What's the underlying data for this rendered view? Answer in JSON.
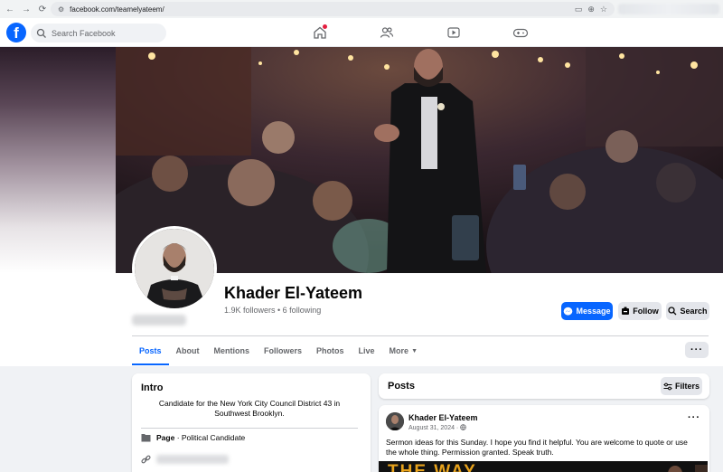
{
  "browser": {
    "url": "facebook.com/teamelyateem/"
  },
  "fb": {
    "search_placeholder": "Search Facebook"
  },
  "profile": {
    "name": "Khader El-Yateem",
    "stats": "1.9K followers • 6 following",
    "buttons": {
      "message": "Message",
      "follow": "Follow",
      "search": "Search"
    }
  },
  "tabs": [
    "Posts",
    "About",
    "Mentions",
    "Followers",
    "Photos",
    "Live",
    "More"
  ],
  "intro": {
    "title": "Intro",
    "bio": "Candidate for the New York City Council District 43 in Southwest Brooklyn.",
    "page_label": "Page",
    "page_category": " · Political Candidate"
  },
  "posts": {
    "title": "Posts",
    "filters": "Filters",
    "post": {
      "author": "Khader El-Yateem",
      "date": "August 31, 2024 · ",
      "text": "Sermon ideas for this Sunday. I hope you find it helpful. You are welcome to quote or use the whole thing. Permission granted. Speak truth.",
      "media_text": "THE WAY"
    }
  },
  "colors": {
    "fb_blue": "#0866ff",
    "notif_red": "#e41e3f"
  }
}
